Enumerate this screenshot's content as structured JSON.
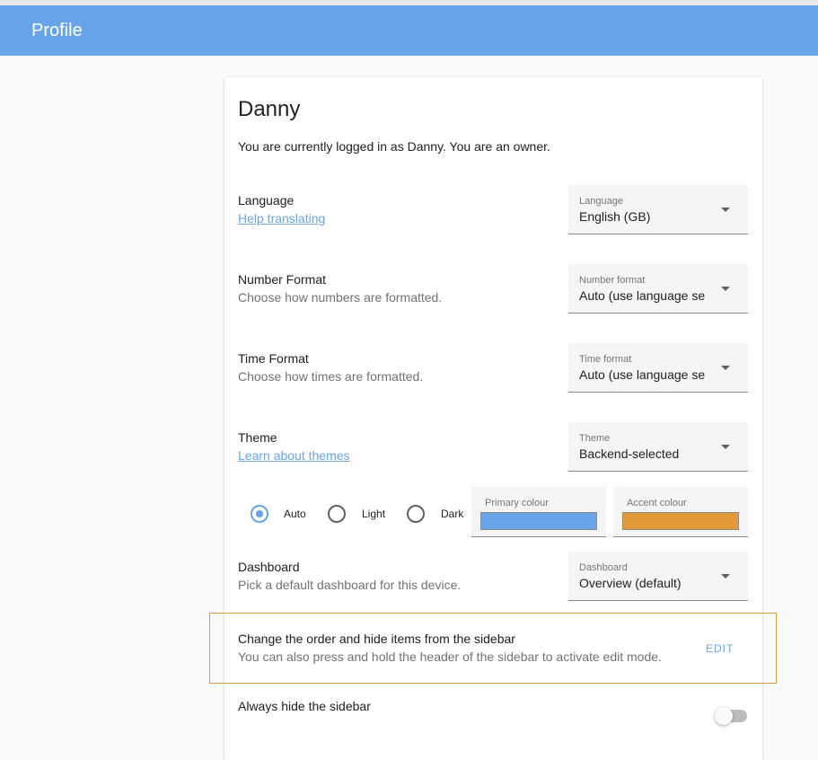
{
  "header": {
    "title": "Profile"
  },
  "profile": {
    "name": "Danny",
    "intro": "You are currently logged in as Danny. You are an owner."
  },
  "language": {
    "heading": "Language",
    "link": "Help translating",
    "select_label": "Language",
    "select_value": "English (GB)"
  },
  "number_format": {
    "heading": "Number Format",
    "description": "Choose how numbers are formatted.",
    "select_label": "Number format",
    "select_value": "Auto (use language se"
  },
  "time_format": {
    "heading": "Time Format",
    "description": "Choose how times are formatted.",
    "select_label": "Time format",
    "select_value": "Auto (use language se"
  },
  "theme": {
    "heading": "Theme",
    "link": "Learn about themes",
    "select_label": "Theme",
    "select_value": "Backend-selected",
    "modes": [
      "Auto",
      "Light",
      "Dark"
    ],
    "selected_mode": "Auto",
    "primary_label": "Primary colour",
    "primary_color": "#68a4e8",
    "accent_label": "Accent colour",
    "accent_color": "#e39a3b"
  },
  "dashboard": {
    "heading": "Dashboard",
    "description": "Pick a default dashboard for this device.",
    "select_label": "Dashboard",
    "select_value": "Overview (default)"
  },
  "sidebar_order": {
    "heading": "Change the order and hide items from the sidebar",
    "description": "You can also press and hold the header of the sidebar to activate edit mode.",
    "button": "EDIT"
  },
  "hide_sidebar": {
    "heading": "Always hide the sidebar",
    "enabled": false
  },
  "colors": {
    "header": "#68a4e8",
    "highlight_border": "#e39a3b"
  }
}
